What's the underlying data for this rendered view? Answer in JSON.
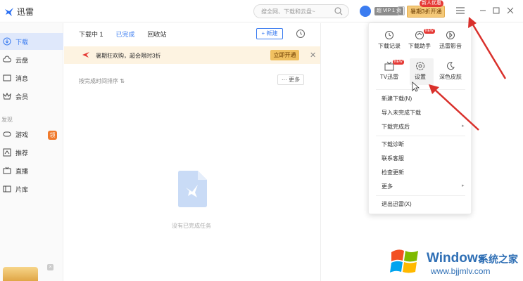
{
  "app": {
    "title": "迅雷"
  },
  "search": {
    "placeholder": "搜全网、下载和云盘~"
  },
  "account": {
    "vip_label": "超 VIP 1 贡",
    "promo_button": "暑期3折开通",
    "promo_tag": "新人优惠"
  },
  "sidebar": {
    "items": [
      {
        "label": "下载",
        "icon": "download-icon"
      },
      {
        "label": "云盘",
        "icon": "cloud-icon"
      },
      {
        "label": "消息",
        "icon": "message-icon"
      },
      {
        "label": "会员",
        "icon": "vip-icon"
      }
    ],
    "section_label": "发现",
    "discover": [
      {
        "label": "游戏",
        "icon": "game-icon"
      },
      {
        "label": "推荐",
        "icon": "recommend-icon"
      },
      {
        "label": "直播",
        "icon": "live-icon"
      },
      {
        "label": "片库",
        "icon": "film-icon"
      }
    ],
    "game_badge": "领"
  },
  "tabs": [
    "下载中 1",
    "已完成",
    "回收站"
  ],
  "toolbar": {
    "new_label": "+ 新建"
  },
  "banner": {
    "text": "暑期狂欢购，超会限时3折",
    "button": "立即开通"
  },
  "list": {
    "sort_label": "按完成时间排序 ⇅",
    "more_label": "··· 更多",
    "empty_text": "没有已完成任务"
  },
  "menu": {
    "grid": [
      {
        "label": "下载记录",
        "icon": "history-icon"
      },
      {
        "label": "下载助手",
        "icon": "helper-icon",
        "tag": "NEW"
      },
      {
        "label": "迅雷影音",
        "icon": "player-icon"
      },
      {
        "label": "TV迅雷",
        "icon": "tv-icon",
        "tag": "NEW"
      },
      {
        "label": "设置",
        "icon": "settings-icon"
      },
      {
        "label": "深色皮肤",
        "icon": "moon-icon"
      }
    ],
    "items": [
      {
        "label": "新建下载(N)"
      },
      {
        "label": "导入未完成下载"
      },
      {
        "label": "下载完成后",
        "submenu": true
      },
      {
        "label": "下载诊断"
      },
      {
        "label": "联系客服"
      },
      {
        "label": "检查更新"
      },
      {
        "label": "更多",
        "submenu": true
      },
      {
        "label": "退出迅雷(X)"
      }
    ]
  },
  "watermark": {
    "title": "Windows",
    "subtitle": "系统之家",
    "url": "www.bjjmlv.com"
  },
  "colors": {
    "accent": "#3b7cf0",
    "annotation": "#d9302b",
    "banner_bg": "#fdf3e1"
  }
}
